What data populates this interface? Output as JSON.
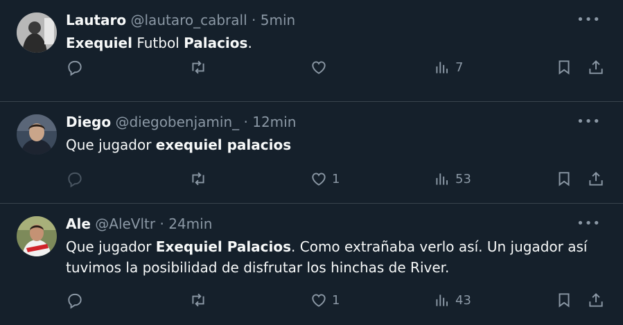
{
  "tweets": [
    {
      "name": "Lautaro",
      "handle": "@lautaro_cabrall",
      "time": "5min",
      "text": [
        {
          "t": "Exequiel",
          "b": true
        },
        {
          "t": " Futbol ",
          "b": false
        },
        {
          "t": "Palacios",
          "b": true
        },
        {
          "t": ".",
          "b": false
        }
      ],
      "likes": "",
      "views": "7"
    },
    {
      "name": "Diego",
      "handle": "@diegobenjamin_",
      "time": "12min",
      "text": [
        {
          "t": "Que jugador ",
          "b": false
        },
        {
          "t": "exequiel palacios",
          "b": true
        }
      ],
      "likes": "1",
      "views": "53"
    },
    {
      "name": "Ale",
      "handle": "@AleVltr",
      "time": "24min",
      "text": [
        {
          "t": "Que jugador ",
          "b": false
        },
        {
          "t": "Exequiel Palacios",
          "b": true
        },
        {
          "t": ". Como extrañaba verlo así. Un jugador así tuvimos la posibilidad de disfrutar los hinchas de River.",
          "b": false
        }
      ],
      "likes": "1",
      "views": "43"
    }
  ],
  "separator": " · ",
  "more_glyph": "•••",
  "colors": {
    "background": "#15202b",
    "muted": "#8b98a5",
    "text": "#f7f9f9",
    "divider": "#38444d"
  },
  "icons": [
    "reply-icon",
    "retweet-icon",
    "like-icon",
    "views-icon",
    "bookmark-icon",
    "share-icon",
    "more-icon"
  ]
}
